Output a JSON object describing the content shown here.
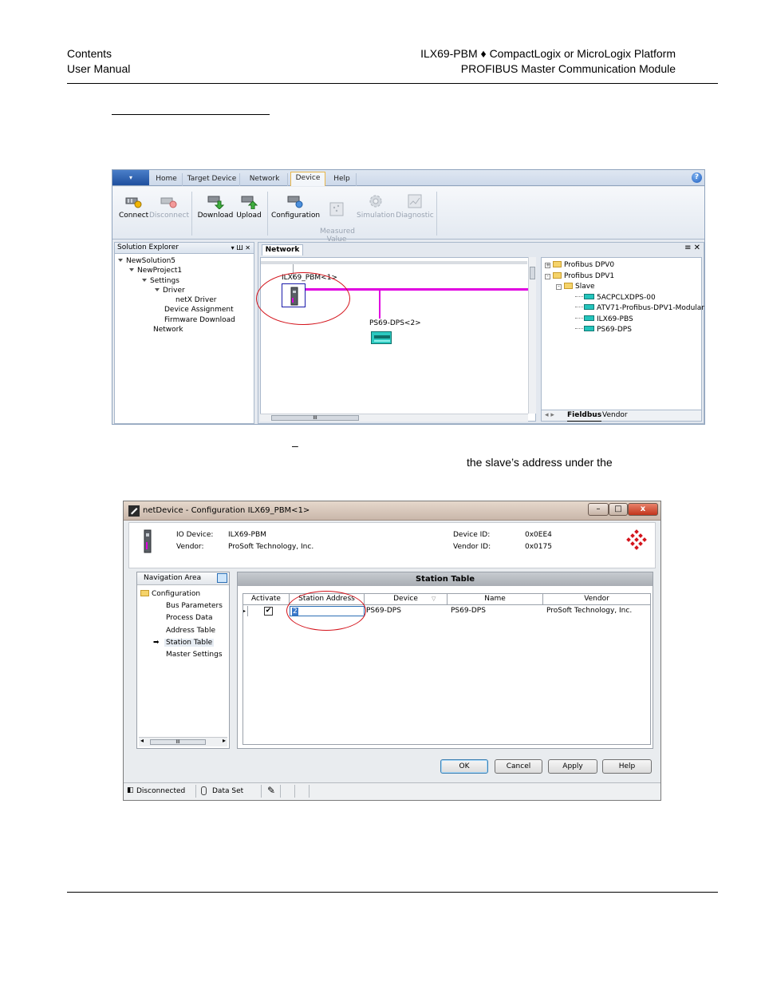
{
  "header": {
    "left_line1": "Contents",
    "left_line2": "User Manual",
    "right_line1": "ILX69-PBM ♦ CompactLogix or MicroLogix Platform",
    "right_line2": "PROFIBUS Master Communication Module"
  },
  "body_fragments": {
    "dash": "–",
    "slave_address_text": "the slave’s address under the"
  },
  "screen1": {
    "app_button": "▾",
    "tabs": [
      "Home",
      "Target Device",
      "Network",
      "Device",
      "Help"
    ],
    "active_tab": "Device",
    "help_glyph": "?",
    "ribbon_buttons": [
      {
        "label": "Connect",
        "enabled": true
      },
      {
        "label": "Disconnect",
        "enabled": false
      },
      {
        "label": "Download",
        "enabled": true
      },
      {
        "label": "Upload",
        "enabled": true
      },
      {
        "label": "Configuration",
        "enabled": true
      },
      {
        "label": "Measured\nValue",
        "enabled": false
      },
      {
        "label": "Simulation",
        "enabled": false
      },
      {
        "label": "Diagnostic",
        "enabled": false
      }
    ],
    "solution_explorer": {
      "title": "Solution Explorer",
      "pane_controls": "▾ Ш ✕",
      "items": [
        "NewSolution5",
        "NewProject1",
        "Settings",
        "Driver",
        "netX Driver",
        "Device Assignment",
        "Firmware Download",
        "Network"
      ]
    },
    "network": {
      "tab": "Network",
      "master_label": "ILX69_PBM<1>",
      "slave_label": "PS69-DPS<2>",
      "scroll_mark": "III",
      "pane_controls": "≡ ✕"
    },
    "catalog": {
      "items": [
        "Profibus DPV0",
        "Profibus DPV1",
        "Slave",
        "5ACPCLXDPS-00",
        "ATV71-Profibus-DPV1-Modular",
        "ILX69-PBS",
        "PS69-DPS"
      ],
      "tabs": [
        "Fieldbus",
        "Vendor"
      ]
    },
    "accent_color": "#e000e0"
  },
  "screen2": {
    "title": "netDevice - Configuration ILX69_PBM<1>",
    "window_buttons": [
      "–",
      "□",
      "x"
    ],
    "info": {
      "io_device_label": "IO Device:",
      "io_device": "ILX69-PBM",
      "vendor_label": "Vendor:",
      "vendor": "ProSoft Technology, Inc.",
      "device_id_label": "Device ID:",
      "device_id": "0x0EE4",
      "vendor_id_label": "Vendor ID:",
      "vendor_id": "0x0175"
    },
    "nav": {
      "title": "Navigation Area",
      "root": "Configuration",
      "items": [
        "Bus Parameters",
        "Process Data",
        "Address Table",
        "Station Table",
        "Master Settings"
      ],
      "selected": "Station Table",
      "scroll_mark": "III"
    },
    "station_table": {
      "title": "Station Table",
      "columns": [
        "Activate",
        "Station Address",
        "Device",
        "Name",
        "Vendor"
      ],
      "rows": [
        {
          "activate": true,
          "station_address": "2",
          "device": "PS69-DPS",
          "name": "PS69-DPS",
          "vendor": "ProSoft Technology, Inc."
        }
      ]
    },
    "buttons": [
      "OK",
      "Cancel",
      "Apply",
      "Help"
    ],
    "status": {
      "connection": "Disconnected",
      "dataset": "Data Set"
    }
  }
}
